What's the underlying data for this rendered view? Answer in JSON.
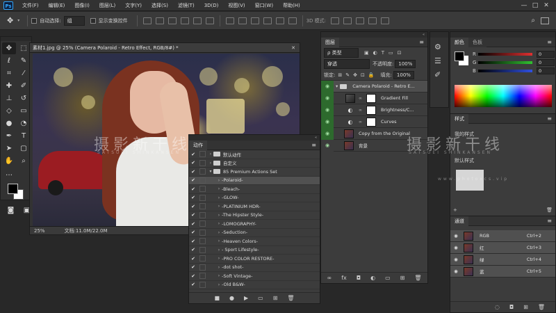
{
  "menubar": {
    "logo": "Ps",
    "items": [
      "文件(F)",
      "编辑(E)",
      "图像(I)",
      "图层(L)",
      "文字(Y)",
      "选择(S)",
      "滤镜(T)",
      "3D(D)",
      "视图(V)",
      "窗口(W)",
      "帮助(H)"
    ],
    "min": "—",
    "max": "□",
    "close": "✕"
  },
  "optbar": {
    "auto_select_label": "自动选择:",
    "auto_select_value": "组",
    "show_transform_label": "显示变换控件",
    "mode_3d_label": "3D 模式:"
  },
  "document": {
    "tab_title": "素材1.jpg @ 25% (Camera Polaroid - Retro Effect, RGB/8#) *",
    "zoom": "25%",
    "doc_info": "文档:11.0M/22.0M"
  },
  "actions_panel": {
    "tab_label": "动作",
    "rows": [
      {
        "label": "默认动作",
        "kind": "set",
        "checked": true
      },
      {
        "label": "自定义",
        "kind": "set",
        "checked": true
      },
      {
        "label": "85 Premium Actions Set",
        "kind": "set-open",
        "checked": true
      },
      {
        "label": "-Polaroid-",
        "kind": "action",
        "checked": true,
        "selected": true
      },
      {
        "label": "-Bleach-",
        "kind": "action",
        "checked": true
      },
      {
        "label": "-GLOW-",
        "kind": "action",
        "checked": true
      },
      {
        "label": "-PLATINIUM HDR-",
        "kind": "action",
        "checked": true
      },
      {
        "label": "-The Hipster Style-",
        "kind": "action",
        "checked": true
      },
      {
        "label": "-LOMOGRAPHY-",
        "kind": "action",
        "checked": true
      },
      {
        "label": "-Seduction-",
        "kind": "action",
        "checked": true
      },
      {
        "label": "-Heaven Colors-",
        "kind": "action",
        "checked": true
      },
      {
        "label": "- Sport Lifestyle-",
        "kind": "action",
        "checked": true
      },
      {
        "label": "-PRO COLOR RESTORE-",
        "kind": "action",
        "checked": true
      },
      {
        "label": "-dot shot-",
        "kind": "action",
        "checked": true
      },
      {
        "label": "-Soft Vintage-",
        "kind": "action",
        "checked": true
      },
      {
        "label": "-Old B&W-",
        "kind": "action",
        "checked": true
      }
    ]
  },
  "layers_panel": {
    "tab_label": "图层",
    "kind_filter": "ρ 类型",
    "blend_mode": "穿透",
    "opacity_label": "不透明度:",
    "opacity_value": "100%",
    "lock_label": "锁定:",
    "fill_label": "填充:",
    "fill_value": "100%",
    "layers": [
      {
        "name": "Camera Polaroid - Retro E...",
        "type": "group",
        "visible": true,
        "selected": true
      },
      {
        "name": "Gradient Fill",
        "type": "gradient",
        "visible": true
      },
      {
        "name": "Brightness/C...",
        "type": "adjust",
        "visible": true
      },
      {
        "name": "Curves",
        "type": "adjust",
        "visible": true
      },
      {
        "name": "Copy from the Original",
        "type": "photo",
        "visible": true
      },
      {
        "name": "背景",
        "type": "photo",
        "visible": true
      }
    ]
  },
  "color_panel": {
    "tabs": [
      "颜色",
      "色板"
    ],
    "channels": [
      {
        "label": "R",
        "value": "0",
        "color": "#e03030"
      },
      {
        "label": "G",
        "value": "0",
        "color": "#30c030"
      },
      {
        "label": "B",
        "value": "0",
        "color": "#3050e0"
      }
    ]
  },
  "adjust_panel": {
    "tab_label": "样式",
    "preset_label": "我的样式",
    "style_label": "默认样式"
  },
  "channels_panel": {
    "tab_label": "通道",
    "rows": [
      {
        "name": "RGB",
        "shortcut": "Ctrl+2"
      },
      {
        "name": "红",
        "shortcut": "Ctrl+3"
      },
      {
        "name": "绿",
        "shortcut": "Ctrl+4"
      },
      {
        "name": "蓝",
        "shortcut": "Ctrl+5"
      }
    ]
  },
  "watermark": {
    "main": "摄影新干线",
    "sub": "SATSUEI SHINKANSEN",
    "url": "www.photoxcs.vip"
  },
  "colors": {
    "foreground": "#000000",
    "background": "#ffffff",
    "visibility_green": "#2d6a2d"
  }
}
